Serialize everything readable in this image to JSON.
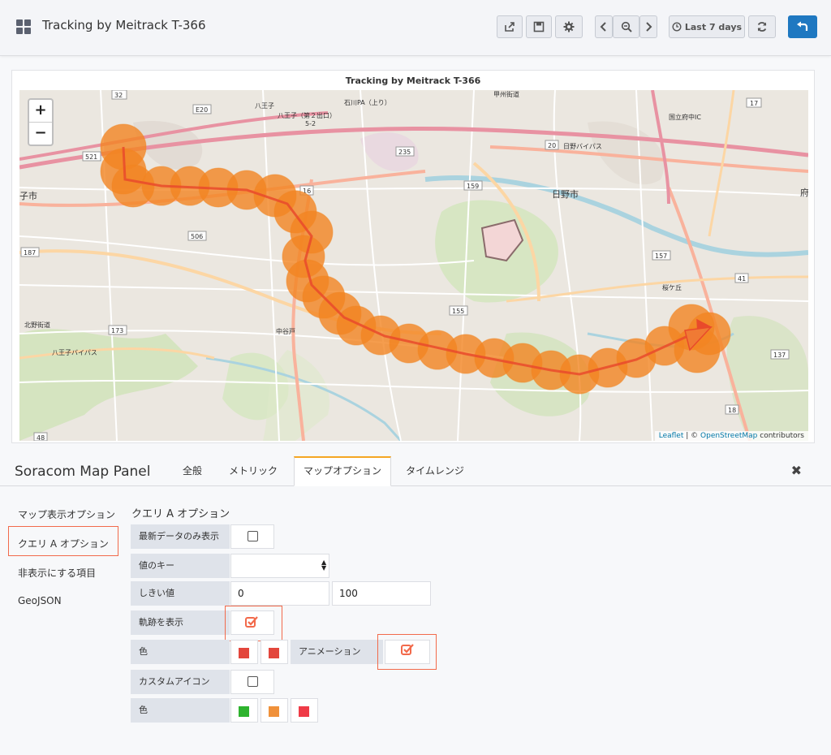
{
  "header": {
    "title": "Tracking by Meitrack T-366",
    "time_range": "Last 7 days"
  },
  "panel": {
    "title": "Tracking by Meitrack T-366",
    "zoom_in": "+",
    "zoom_out": "−",
    "attribution": {
      "leaflet": "Leaflet",
      "sep": " | © ",
      "osm": "OpenStreetMap",
      "suffix": " contributors"
    }
  },
  "map_labels": [
    {
      "text": "32"
    },
    {
      "text": "E20"
    },
    {
      "text": "八王子"
    },
    {
      "text": "石川PA（上り）"
    },
    {
      "text": "八王子（第２出口）"
    },
    {
      "text": "5-2"
    },
    {
      "text": "甲州街道"
    },
    {
      "text": "国立府中IC"
    },
    {
      "text": "17"
    },
    {
      "text": "521"
    },
    {
      "text": "235"
    },
    {
      "text": "20"
    },
    {
      "text": "日野バイパス"
    },
    {
      "text": "16"
    },
    {
      "text": "159"
    },
    {
      "text": "日野市"
    },
    {
      "text": "506"
    },
    {
      "text": "187"
    },
    {
      "text": "157"
    },
    {
      "text": "41"
    },
    {
      "text": "173"
    },
    {
      "text": "155"
    },
    {
      "text": "137"
    },
    {
      "text": "18"
    },
    {
      "text": "48"
    },
    {
      "text": "八王子バイパス"
    },
    {
      "text": "北野街道"
    },
    {
      "text": "中谷戸"
    },
    {
      "text": "桜ケ丘"
    },
    {
      "text": "府"
    },
    {
      "text": "子市"
    }
  ],
  "editor": {
    "title": "Soracom Map Panel",
    "tabs": [
      "全般",
      "メトリック",
      "マップオプション",
      "タイムレンジ"
    ],
    "sidenav": [
      "マップ表示オプション",
      "クエリ A オプション",
      "非表示にする項目",
      "GeoJSON"
    ],
    "section_title": "クエリ A オプション",
    "fields": {
      "latest_only": {
        "label": "最新データのみ表示",
        "checked": false
      },
      "value_key": {
        "label": "値のキー",
        "value": ""
      },
      "threshold": {
        "label": "しきい値",
        "min": "0",
        "max": "100"
      },
      "show_track": {
        "label": "軌跡を表示",
        "checked": true
      },
      "color": {
        "label": "色",
        "colors": [
          "#e3463c",
          "#e3463c"
        ]
      },
      "animation": {
        "label": "アニメーション",
        "checked": true
      },
      "custom_icon": {
        "label": "カスタムアイコン",
        "checked": false
      },
      "icon_color": {
        "label": "色",
        "colors": [
          "#2eb32e",
          "#f0913a",
          "#ef3b47"
        ]
      }
    }
  },
  "colors": {
    "accent_orange": "#f26a4b",
    "track_orange": "#f28522",
    "track_line": "#e94a2b",
    "primary_blue": "#1f78c1"
  }
}
